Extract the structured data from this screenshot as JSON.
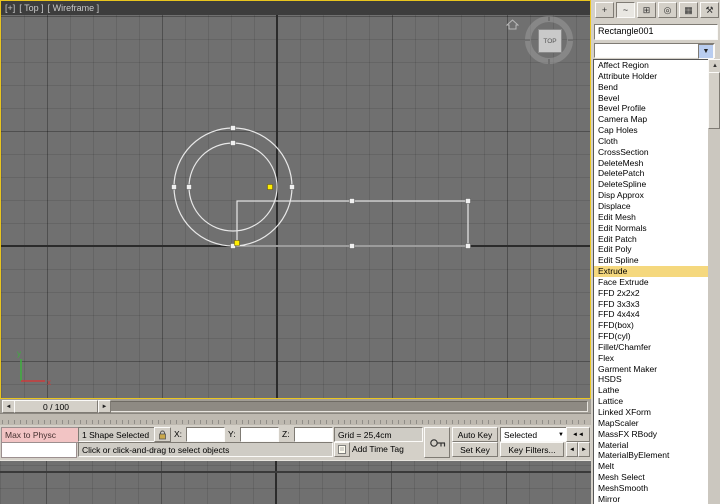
{
  "viewport": {
    "title_segments": {
      "menu": "[+]",
      "view": "[ Top ]",
      "shading": "[ Wireframe ]"
    },
    "viewcube_label": "TOP",
    "axis": {
      "x": "x",
      "y": "y"
    }
  },
  "command_panel": {
    "active_tab": "modify",
    "tabs": [
      {
        "name": "create",
        "glyph": "+"
      },
      {
        "name": "modify",
        "glyph": "~"
      },
      {
        "name": "hierarchy",
        "glyph": "⊞"
      },
      {
        "name": "motion",
        "glyph": "◎"
      },
      {
        "name": "display",
        "glyph": "▦"
      },
      {
        "name": "utilities",
        "glyph": "⚒"
      }
    ],
    "object_name": "Rectangle001",
    "modifier_combo_value": "",
    "combo_arrow_glyph": "▼",
    "scroll_up_glyph": "▲",
    "selected_modifier": "Extrude",
    "modifier_list": [
      "Affect Region",
      "Attribute Holder",
      "Bend",
      "Bevel",
      "Bevel Profile",
      "Camera Map",
      "Cap Holes",
      "Cloth",
      "CrossSection",
      "DeleteMesh",
      "DeletePatch",
      "DeleteSpline",
      "Disp Approx",
      "Displace",
      "Edit Mesh",
      "Edit Normals",
      "Edit Patch",
      "Edit Poly",
      "Edit Spline",
      "Extrude",
      "Face Extrude",
      "FFD 2x2x2",
      "FFD 3x3x3",
      "FFD 4x4x4",
      "FFD(box)",
      "FFD(cyl)",
      "Fillet/Chamfer",
      "Flex",
      "Garment Maker",
      "HSDS",
      "Lathe",
      "Lattice",
      "Linked XForm",
      "MapScaler",
      "MassFX RBody",
      "Material",
      "MaterialByElement",
      "Melt",
      "Mesh Select",
      "MeshSmooth",
      "Mirror"
    ]
  },
  "timeline": {
    "slider_label": "0 / 100",
    "prev_glyph": "◄",
    "next_glyph": "►"
  },
  "status_bar": {
    "macro_recorder_text": "Max to Physc",
    "selection_status": "1 Shape Selected",
    "coord_labels": {
      "x": "X:",
      "y": "Y:",
      "z": "Z:"
    },
    "coord_values": {
      "x": "",
      "y": "",
      "z": ""
    },
    "grid_setting": "Grid = 25,4cm",
    "prompt": "Click or click-and-drag to select objects",
    "add_time_tag": "Add Time Tag",
    "auto_key_label": "Auto Key",
    "set_key_label": "Set Key",
    "key_filters_label": "Key Filters...",
    "selected_filter": "Selected",
    "go_to_start_glyph": "◄◄",
    "prev_frame_glyph": "◄",
    "play_glyph": "►"
  },
  "colors": {
    "viewport_border": "#e9c51e",
    "selection_highlight": "#f5d87e",
    "macro_recorder_bg": "#f2c4c4"
  }
}
